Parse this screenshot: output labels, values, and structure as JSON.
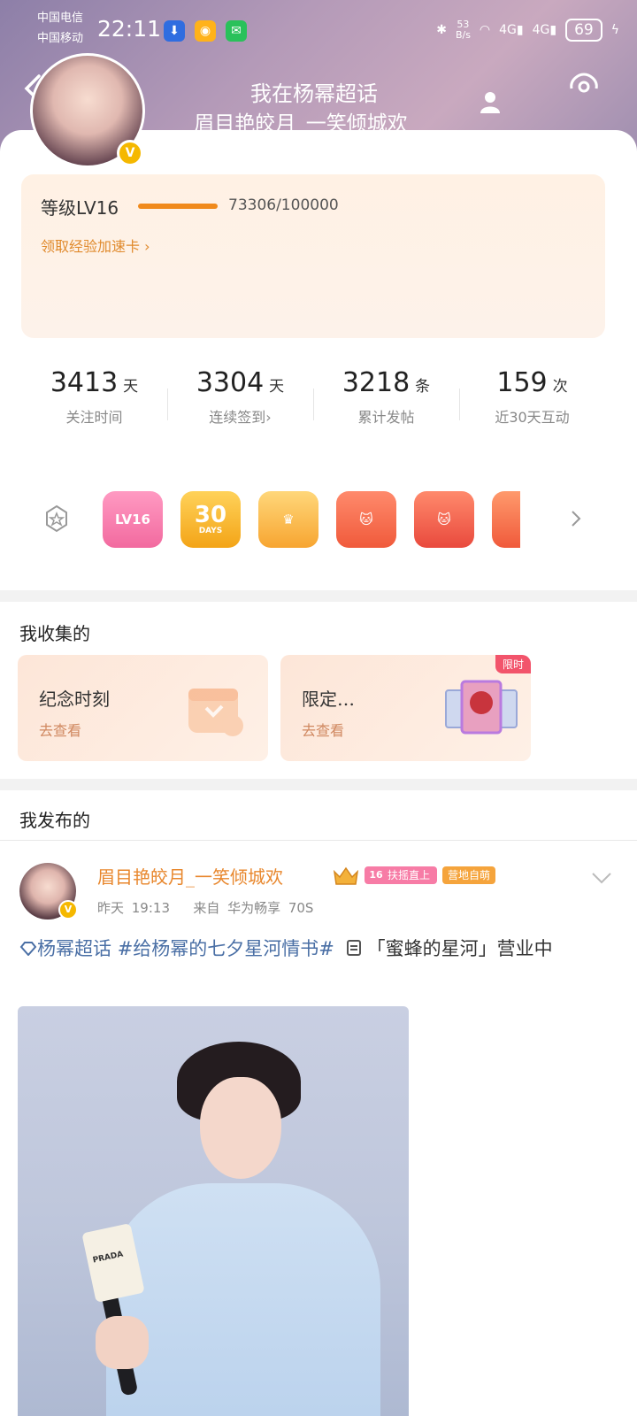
{
  "status_bar": {
    "carrier1": "中国电信",
    "carrier2": "中国移动",
    "time": "22:11",
    "net_speed_value": "53",
    "net_speed_unit": "B/s",
    "signal1": "4G",
    "signal2": "4G",
    "battery": "69"
  },
  "header": {
    "title": "我在杨幂超话",
    "username": "眉目艳皎月_一笑倾城欢",
    "verified_badge": "V"
  },
  "level": {
    "label": "等级LV16",
    "exp_text": "73306/100000",
    "progress": 0.73306,
    "link": "领取经验加速卡"
  },
  "stats": [
    {
      "value": "3413",
      "unit": "天",
      "label": "关注时间"
    },
    {
      "value": "3304",
      "unit": "天",
      "label": "连续签到"
    },
    {
      "value": "3218",
      "unit": "条",
      "label": "累计发帖"
    },
    {
      "value": "159",
      "unit": "次",
      "label": "近30天互动"
    }
  ],
  "badges": {
    "items": [
      "LV16",
      "30",
      "crown",
      "cat1",
      "cat2",
      "cat3"
    ],
    "days_caption": "DAYS"
  },
  "collections": {
    "title": "我收集的",
    "cards": [
      {
        "title": "纪念时刻",
        "sub": "去查看"
      },
      {
        "title": "限定…",
        "sub": "去查看",
        "tag": "限时"
      }
    ]
  },
  "posts": {
    "title": "我发布的",
    "item": {
      "author": "眉目艳皎月_一笑倾城欢",
      "level_tag_num": "16",
      "level_tag": "扶摇直上",
      "role_tag": "营地自萌",
      "time": "昨天 19:13",
      "source": "来自 华为畅享 70S",
      "topic_tag": "杨幂超话",
      "hashtag": "#给杨幂的七夕星河情书#",
      "quote_text": "「蜜蜂的星河」营业中",
      "mic_brand": "PRADA"
    }
  },
  "colors": {
    "accent_orange": "#f08a1c",
    "name_orange": "#e8872d",
    "topic_blue": "#4a6fa5",
    "limit_red": "#f2546b"
  }
}
